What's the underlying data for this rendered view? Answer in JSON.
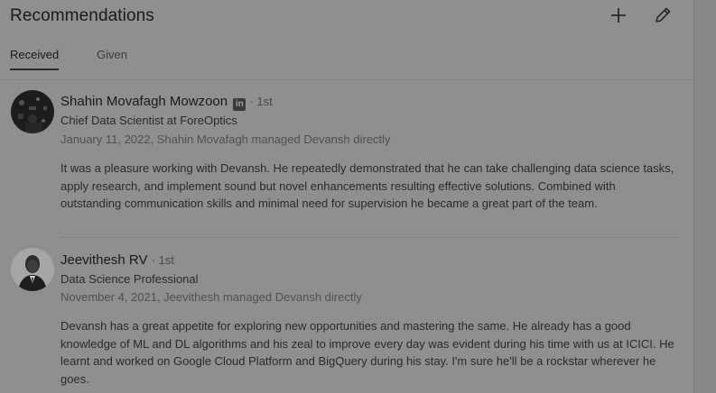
{
  "header": {
    "title": "Recommendations",
    "add_icon": "plus-icon",
    "edit_icon": "pencil-icon"
  },
  "tabs": [
    {
      "label": "Received",
      "active": true
    },
    {
      "label": "Given",
      "active": false
    }
  ],
  "recommendations": [
    {
      "name": "Shahin Movafagh Mowzoon",
      "badge": "in",
      "degree": "· 1st",
      "headline": "Chief Data Scientist at ForeOptics",
      "meta": "January 11, 2022, Shahin Movafagh managed Devansh directly",
      "text": "It was a pleasure working with Devansh. He repeatedly demonstrated that he can take challenging data science tasks, apply research, and implement sound but novel enhancements resulting effective solutions. Combined with outstanding communication skills and minimal need for supervision he became a great part of the team."
    },
    {
      "name": "Jeevithesh RV",
      "degree": "· 1st",
      "headline": "Data Science Professional",
      "meta": "November 4, 2021, Jeevithesh managed Devansh directly",
      "text": "Devansh has a great appetite for exploring new opportunities and mastering the same. He already has a good knowledge of ML and DL algorithms and his zeal to improve every day was evident during his time with us at ICICI. He learnt and worked on Google Cloud Platform and BigQuery during his stay. I'm sure he'll be a rockstar wherever he goes."
    }
  ]
}
